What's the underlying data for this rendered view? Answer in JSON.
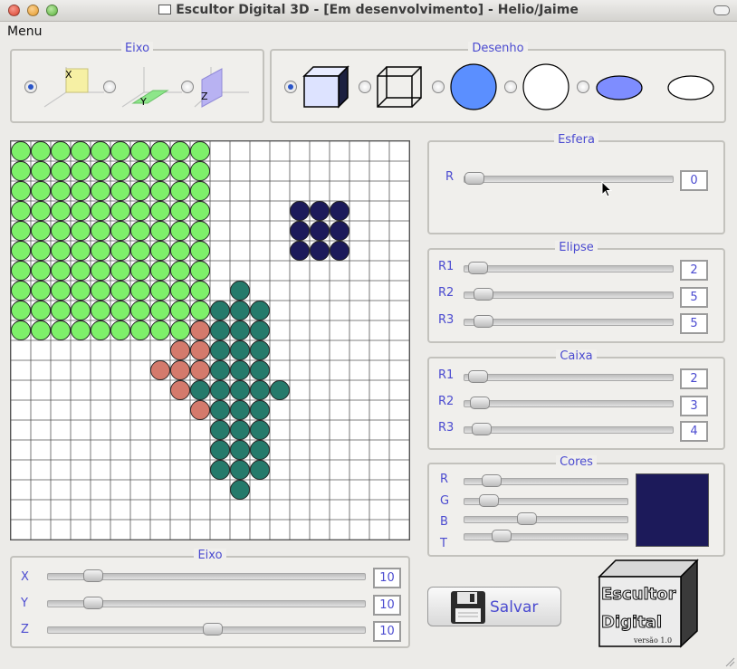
{
  "window": {
    "title": "Escultor Digital 3D - [Em desenvolvimento] - Helio/Jaime",
    "menu": "Menu"
  },
  "eixo_top": {
    "title": "Eixo",
    "options": [
      {
        "axis_label": "X",
        "selected": true
      },
      {
        "axis_label": "Y",
        "selected": false
      },
      {
        "axis_label": "Z",
        "selected": false
      }
    ]
  },
  "desenho": {
    "title": "Desenho",
    "options": [
      {
        "icon": "solid-box-icon",
        "selected": true
      },
      {
        "icon": "wire-box-icon",
        "selected": false
      },
      {
        "icon": "solid-sphere-icon",
        "selected": false
      },
      {
        "icon": "wire-sphere-icon",
        "selected": false
      },
      {
        "icon": "solid-ellipse-icon",
        "selected": false
      },
      {
        "icon": "wire-ellipse-icon",
        "selected": false
      }
    ]
  },
  "esfera": {
    "title": "Esfera",
    "label": "R",
    "value": "0",
    "fraction": 0.0
  },
  "elipse": {
    "title": "Elipse",
    "sliders": [
      {
        "label": "R1",
        "value": "2",
        "fraction": 0.02
      },
      {
        "label": "R2",
        "value": "5",
        "fraction": 0.05
      },
      {
        "label": "R3",
        "value": "5",
        "fraction": 0.05
      }
    ]
  },
  "caixa": {
    "title": "Caixa",
    "sliders": [
      {
        "label": "R1",
        "value": "2",
        "fraction": 0.02
      },
      {
        "label": "R2",
        "value": "3",
        "fraction": 0.03
      },
      {
        "label": "R3",
        "value": "4",
        "fraction": 0.04
      }
    ]
  },
  "cores": {
    "title": "Cores",
    "sliders": [
      {
        "label": "R",
        "fraction": 0.12
      },
      {
        "label": "G",
        "fraction": 0.1
      },
      {
        "label": "B",
        "fraction": 0.37
      },
      {
        "label": "T",
        "fraction": 0.19
      }
    ],
    "swatch_color": "#1c1a5a"
  },
  "eixo_bottom": {
    "title": "Eixo",
    "sliders": [
      {
        "label": "X",
        "value": "10",
        "fraction": 0.12
      },
      {
        "label": "Y",
        "value": "10",
        "fraction": 0.12
      },
      {
        "label": "Z",
        "value": "10",
        "fraction": 0.52
      }
    ]
  },
  "save": {
    "label": "Salvar"
  },
  "logo": {
    "line1": "Escultor",
    "line2": "Digital",
    "version": "versão 1.0"
  },
  "grid": {
    "cols": 20,
    "rows": 20,
    "colors": {
      "green": "#7ef06a",
      "navy": "#1c1a5a",
      "teal": "#257a6b",
      "salmon": "#d47a6c"
    },
    "green_block": {
      "col_start": 0,
      "row_start": 0,
      "cols": 10,
      "rows": 10
    },
    "navy_cells": [
      [
        14,
        3
      ],
      [
        15,
        3
      ],
      [
        16,
        3
      ],
      [
        14,
        4
      ],
      [
        15,
        4
      ],
      [
        16,
        4
      ],
      [
        14,
        5
      ],
      [
        15,
        5
      ],
      [
        16,
        5
      ]
    ],
    "teal_cells": [
      [
        11,
        7
      ],
      [
        10,
        8
      ],
      [
        11,
        8
      ],
      [
        12,
        8
      ],
      [
        10,
        9
      ],
      [
        11,
        9
      ],
      [
        12,
        9
      ],
      [
        10,
        10
      ],
      [
        11,
        10
      ],
      [
        12,
        10
      ],
      [
        10,
        11
      ],
      [
        11,
        11
      ],
      [
        12,
        11
      ],
      [
        9,
        12
      ],
      [
        10,
        12
      ],
      [
        11,
        12
      ],
      [
        12,
        12
      ],
      [
        13,
        12
      ],
      [
        10,
        13
      ],
      [
        11,
        13
      ],
      [
        12,
        13
      ],
      [
        10,
        14
      ],
      [
        11,
        14
      ],
      [
        12,
        14
      ],
      [
        10,
        15
      ],
      [
        11,
        15
      ],
      [
        12,
        15
      ],
      [
        10,
        16
      ],
      [
        11,
        16
      ],
      [
        12,
        16
      ],
      [
        11,
        17
      ]
    ],
    "salmon_cells": [
      [
        9,
        9
      ],
      [
        8,
        10
      ],
      [
        9,
        10
      ],
      [
        7,
        11
      ],
      [
        8,
        11
      ],
      [
        9,
        11
      ],
      [
        8,
        12
      ],
      [
        9,
        13
      ]
    ]
  }
}
